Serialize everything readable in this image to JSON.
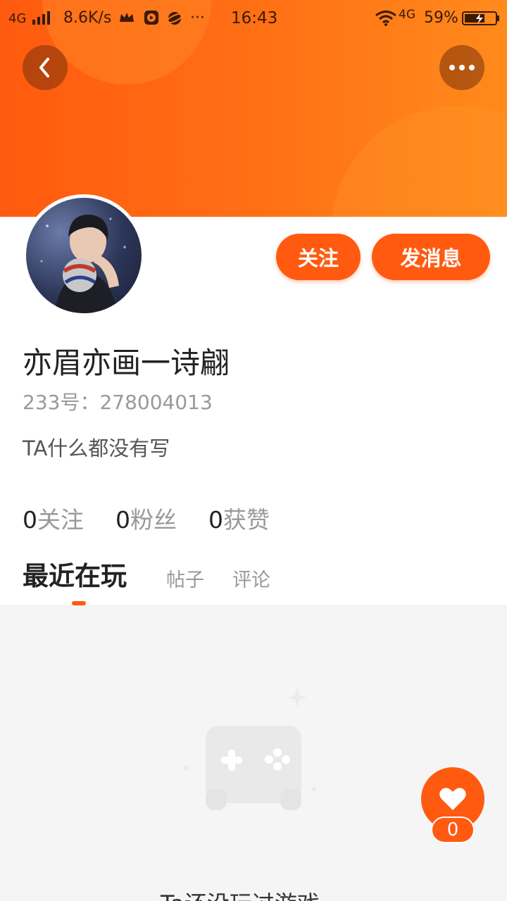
{
  "status_bar": {
    "network": "4G",
    "speed": "8.6K/s",
    "more": "···",
    "time": "16:43",
    "network_right": "4G",
    "battery_percent": "59%"
  },
  "header": {
    "back_icon": "chevron-left-icon",
    "more_icon": "more-horizontal-icon"
  },
  "profile": {
    "username": "亦眉亦画一诗翩",
    "user_id": "233号：278004013",
    "bio": "TA什么都没有写",
    "follow_button": "关注",
    "message_button": "发消息"
  },
  "stats": {
    "following_count": "0",
    "following_label": "关注",
    "fans_count": "0",
    "fans_label": "粉丝",
    "likes_count": "0",
    "likes_label": "获赞"
  },
  "tabs": [
    {
      "label": "最近在玩",
      "active": true
    },
    {
      "label": "帖子",
      "active": false
    },
    {
      "label": "评论",
      "active": false
    }
  ],
  "content": {
    "empty_text": "Ta还没玩过游戏"
  },
  "like_widget": {
    "count": "0",
    "icon": "heart-icon"
  },
  "colors": {
    "accent": "#ff5a10",
    "header_gradient_start": "#ff5a10",
    "header_gradient_end": "#ff8a1c"
  }
}
